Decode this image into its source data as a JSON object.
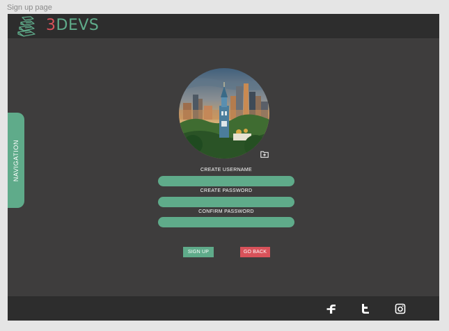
{
  "frame": {
    "title": "Sign up page"
  },
  "brand": {
    "prefix": "3",
    "name": "DEVS"
  },
  "nav": {
    "label": "NAVIGATION"
  },
  "form": {
    "username_label": "CREATE USERNAME",
    "password_label": "CREATE PASSWORD",
    "confirm_label": "CONFIRM PASSWORD",
    "username_value": "",
    "password_value": "",
    "confirm_value": ""
  },
  "buttons": {
    "signup": "SIGN UP",
    "go_back": "GO BACK"
  },
  "footer": {
    "social": [
      "facebook-icon",
      "twitter-icon",
      "instagram-icon"
    ]
  },
  "colors": {
    "accent_green": "#5fab8a",
    "accent_red": "#d8525a",
    "background": "#3e3d3d",
    "bar": "#2d2d2d"
  }
}
